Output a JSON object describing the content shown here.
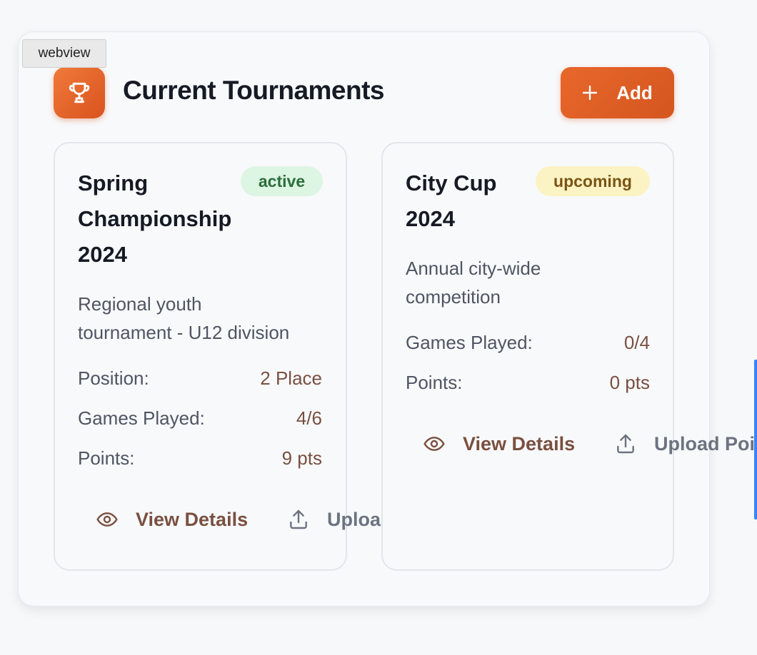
{
  "tooltip": {
    "label": "webview"
  },
  "header": {
    "title": "Current Tournaments",
    "add_label": "Add",
    "icon": "trophy-icon"
  },
  "tournaments": [
    {
      "title_lines": [
        "Spring",
        "Championship",
        "2024"
      ],
      "status": "active",
      "description_lines": [
        "Regional youth",
        "tournament - U12 division"
      ],
      "stats": [
        {
          "label": "Position:",
          "value": "2 Place"
        },
        {
          "label": "Games Played:",
          "value": "4/6"
        },
        {
          "label": "Points:",
          "value": "9 pts"
        }
      ],
      "actions": {
        "view": "View Details",
        "upload": "Upload Points Table"
      }
    },
    {
      "title_lines": [
        "City Cup",
        "2024"
      ],
      "status": "upcoming",
      "description_lines": [
        "Annual city-wide",
        "competition"
      ],
      "stats": [
        {
          "label": "Games Played:",
          "value": "0/4"
        },
        {
          "label": "Points:",
          "value": "0 pts"
        }
      ],
      "actions": {
        "view": "View Details",
        "upload": "Upload Points Table"
      }
    }
  ],
  "colors": {
    "accent": "#e8672b",
    "active_bg": "#ddf5e3",
    "upcoming_bg": "#fcf3c4"
  }
}
